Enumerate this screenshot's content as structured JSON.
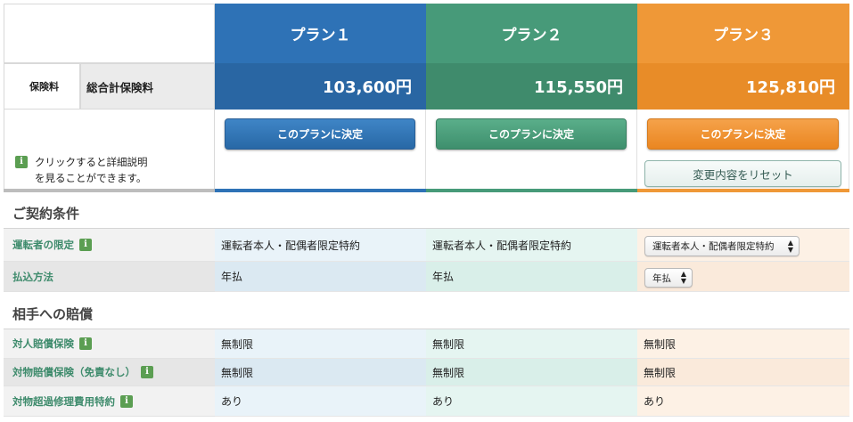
{
  "plans": {
    "names": [
      "プラン１",
      "プラン２",
      "プラン３"
    ],
    "premiums": [
      "103,600円",
      "115,550円",
      "125,810円"
    ],
    "decide_button_label": "このプランに決定",
    "reset_button_label": "変更内容をリセット"
  },
  "premium_row": {
    "category_label": "保険料",
    "total_label": "総合計保険料"
  },
  "info_note": {
    "line1": "クリックすると詳細説明",
    "line2": "を見ることができます。",
    "icon": "info-icon"
  },
  "sections": {
    "contract": {
      "title": "ご契約条件",
      "rows": [
        {
          "label": "運転者の限定",
          "values": [
            "運転者本人・配偶者限定特約",
            "運転者本人・配偶者限定特約"
          ],
          "select_value": "運転者本人・配偶者限定特約"
        },
        {
          "label": "払込方法",
          "values": [
            "年払",
            "年払"
          ],
          "select_value": "年払"
        }
      ]
    },
    "compensation": {
      "title": "相手への賠償",
      "rows": [
        {
          "label": "対人賠償保険",
          "values": [
            "無制限",
            "無制限",
            "無制限"
          ]
        },
        {
          "label": "対物賠償保険（免責なし）",
          "values": [
            "無制限",
            "無制限",
            "無制限"
          ]
        },
        {
          "label": "対物超過修理費用特約",
          "values": [
            "あり",
            "あり",
            "あり"
          ]
        }
      ]
    }
  },
  "colors": {
    "plan1": "#2e72b6",
    "plan2": "#479a79",
    "plan3": "#ef9837",
    "label_text": "#3e8b6c"
  }
}
